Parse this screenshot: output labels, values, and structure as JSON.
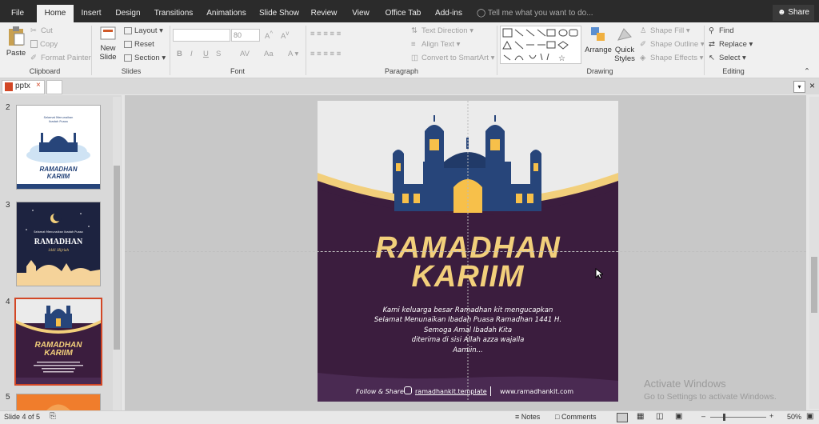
{
  "tabs": [
    "File",
    "Home",
    "Insert",
    "Design",
    "Transitions",
    "Animations",
    "Slide Show",
    "Review",
    "View",
    "Office Tab",
    "Add-ins"
  ],
  "tell_me": "Tell me what you want to do...",
  "share": "Share",
  "ribbon": {
    "clipboard": {
      "label": "Clipboard",
      "paste": "Paste",
      "cut": "Cut",
      "copy": "Copy",
      "format_painter": "Format Painter"
    },
    "slides": {
      "label": "Slides",
      "new_slide": "New",
      "new_slide2": "Slide",
      "layout": "Layout",
      "reset": "Reset",
      "section": "Section"
    },
    "font": {
      "label": "Font",
      "size": "80",
      "bold": "B",
      "italic": "I",
      "underline": "U",
      "strike": "S"
    },
    "paragraph": {
      "label": "Paragraph",
      "text_direction": "Text Direction",
      "align_text": "Align Text",
      "smartart": "Convert to SmartArt"
    },
    "drawing": {
      "label": "Drawing",
      "arrange": "Arrange",
      "quick": "Quick",
      "styles": "Styles",
      "shape_fill": "Shape Fill",
      "shape_outline": "Shape Outline",
      "shape_effects": "Shape Effects"
    },
    "editing": {
      "label": "Editing",
      "find": "Find",
      "replace": "Replace",
      "select": "Select"
    }
  },
  "doc_tab": "pptx",
  "thumbnails": [
    {
      "num": "2",
      "title1": "RAMADHAN",
      "title2": "KARIIM"
    },
    {
      "num": "3",
      "title1": "RAMADHAN",
      "subtitle": "1441 Hijriah"
    },
    {
      "num": "4",
      "title1": "RAMADHAN",
      "title2": "KARIIM"
    },
    {
      "num": "5"
    }
  ],
  "slide": {
    "title1": "RAMADHAN",
    "title2": "KARIIM",
    "body": [
      "Kami keluarga besar Ramadhan kit mengucapkan",
      "Selamat Menunaikan Ibadah Puasa Ramadhan 1441 H.",
      "Semoga Amal Ibadah Kita",
      "diterima di sisi Allah azza wajalla",
      "Aamiin..."
    ],
    "follow": "Follow & Share",
    "handle": "ramadhankit.template",
    "url": "www.ramadhankit.com"
  },
  "watermark": {
    "line1": "Activate Windows",
    "line2": "Go to Settings to activate Windows."
  },
  "status": {
    "slide": "Slide 4 of 5",
    "notes": "Notes",
    "comments": "Comments",
    "zoom": "50%"
  },
  "colors": {
    "purple": "#3b1d3e",
    "gold": "#f2cf7b",
    "navy": "#27457a",
    "dark": "#2b2b2b"
  }
}
